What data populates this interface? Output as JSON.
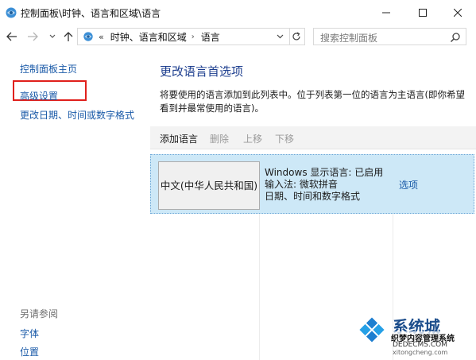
{
  "window": {
    "title": "控制面板\\时钟、语言和区域\\语言"
  },
  "addressbar": {
    "overflow": "«",
    "segment1": "时钟、语言和区域",
    "separator": "›",
    "segment2": "语言"
  },
  "search": {
    "placeholder": "搜索控制面板"
  },
  "sidebar": {
    "home": "控制面板主页",
    "advanced": "高级设置",
    "datetime": "更改日期、时间或数字格式",
    "see_also": "另请参阅",
    "font": "字体",
    "location": "位置"
  },
  "main": {
    "title": "更改语言首选项",
    "description": "将要使用的语言添加到此列表中。位于列表第一位的语言为主语言(即你希望看到并最常使用的语言)。",
    "toolbar": {
      "add": "添加语言",
      "remove": "删除",
      "up": "上移",
      "down": "下移"
    },
    "languages": [
      {
        "name": "中文(中华人民共和国)",
        "display": "Windows 显示语言: 已启用",
        "input": "输入法: 微软拼音",
        "format": "日期、时间和数字格式",
        "options": "选项"
      }
    ]
  },
  "watermark": {
    "brand": "系统城",
    "tag": "织梦内容管理系统",
    "url1": "DEDECMS.COM",
    "url2": "xitongcheng.com"
  },
  "colors": {
    "link": "#1a5aa8",
    "title": "#1e3f8f",
    "selected_row": "#cde8f7",
    "highlight": "#e0201c"
  }
}
